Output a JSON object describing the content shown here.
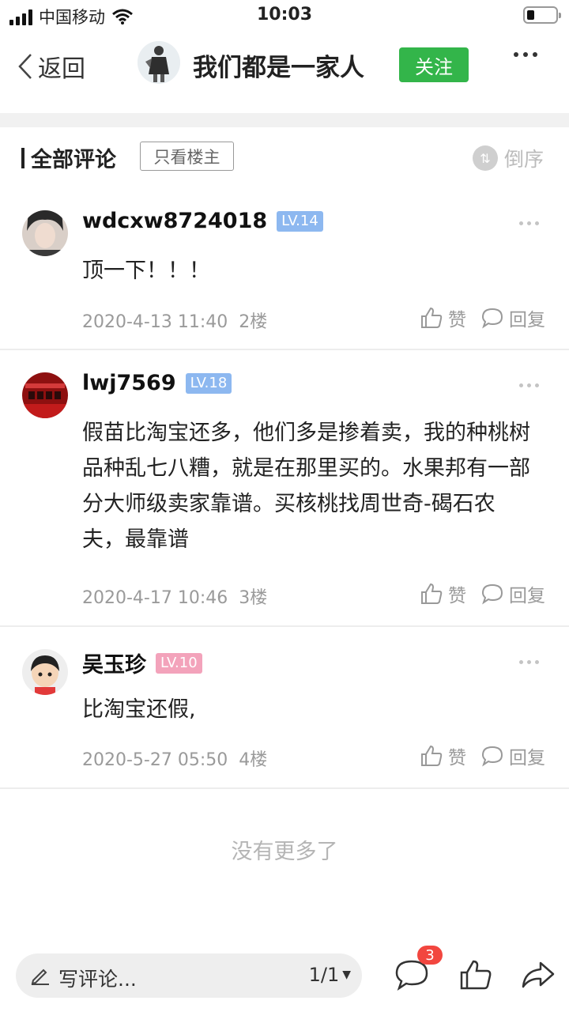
{
  "status_bar": {
    "carrier": "中国移动",
    "time": "10:03"
  },
  "nav": {
    "back_label": "返回",
    "group_title": "我们都是一家人",
    "follow_label": "关注"
  },
  "section": {
    "title": "全部评论",
    "filter_label": "只看楼主",
    "sort_label": "倒序"
  },
  "comments": [
    {
      "username": "wdcxw8724018",
      "level": "LV.14",
      "text": "顶一下！！！",
      "date": "2020-4-13 11:40",
      "floor": "2楼",
      "like_label": "赞",
      "reply_label": "回复"
    },
    {
      "username": "lwj7569",
      "level": "LV.18",
      "text": "假苗比淘宝还多，他们多是掺着卖，我的种桃树品种乱七八糟，就是在那里买的。水果邦有一部分大师级卖家靠谱。买核桃找周世奇-碣石农夫，最靠谱",
      "date": "2020-4-17 10:46",
      "floor": "3楼",
      "like_label": "赞",
      "reply_label": "回复"
    },
    {
      "username": "吴玉珍",
      "level": "LV.10",
      "text": "比淘宝还假,",
      "date": "2020-5-27 05:50",
      "floor": "4楼",
      "like_label": "赞",
      "reply_label": "回复"
    }
  ],
  "footer_note": "没有更多了",
  "bottom_bar": {
    "write_placeholder": "写评论...",
    "page_indicator": "1/1",
    "comment_count_badge": "3"
  },
  "colors": {
    "follow_green": "#33b54a",
    "level_blue": "#8db8f0",
    "level_pink": "#f3a3bb",
    "badge_red": "#f2463f"
  }
}
